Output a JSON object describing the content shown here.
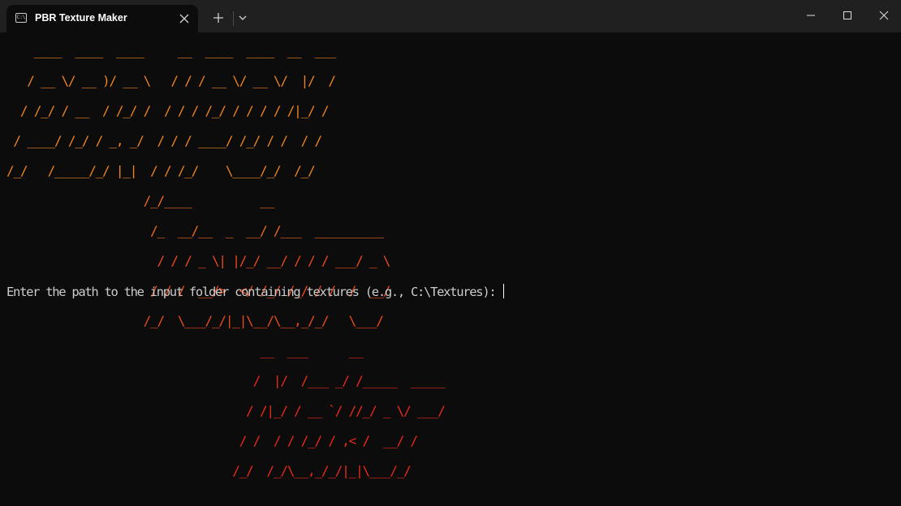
{
  "window": {
    "tab_title": "PBR Texture Maker",
    "tab_icon": "terminal-icon",
    "tab_icon_glyph": "C:\\"
  },
  "banner": {
    "colors": {
      "orange": "#f0841f",
      "orange_red": "#f06a1e",
      "red_orange": "#ed4a1d",
      "red": "#ec2a1a"
    },
    "lines": [
      "    ____  ____  ____     __  ____  ____  __  ___",
      "   / __ \\/ __ )/ __ \\   / / / __ \\/ __ \\/  |/  /",
      "  / /_/ / __  / /_/ /  / / / /_/ / / / / /|_/ /",
      " / ____/ /_/ / _, _/  / / / ____/ /_/ / /  / /",
      "/_/   /_____/_/ |_|  / / /_/    \\____/_/  /_/",
      "                    /_/____          __",
      "                     /_  __/__  _  __/ /___  __________",
      "                      / / / _ \\| |/_/ __/ / / / ___/ _ \\",
      "                     / / /  __/>  </ /_/ /_/ / /  /  __/",
      "                    /_/  \\___/_/|_|\\__/\\__,_/_/   \\___/",
      "                                     __  ___      __",
      "                                    /  |/  /___ _/ /_____  _____",
      "                                   / /|_/ / __ `/ //_/ _ \\/ ___/",
      "                                  / /  / / /_/ / ,< /  __/ /",
      "                                 /_/  /_/\\__,_/_/|_|\\___/_/"
    ]
  },
  "console": {
    "prompt": "Enter the path to the input folder containing textures (e.g., C:\\Textures): "
  }
}
